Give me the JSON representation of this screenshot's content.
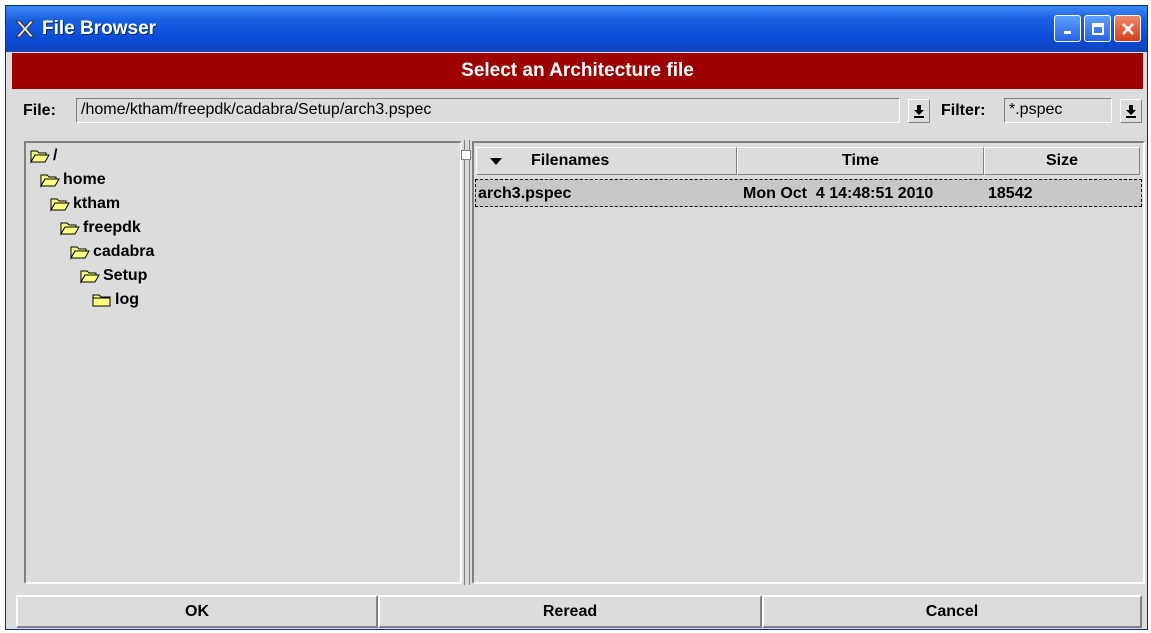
{
  "window": {
    "title": "File Browser",
    "buttons": [
      "minimize",
      "maximize",
      "close"
    ]
  },
  "header": {
    "text": "Select an Architecture file"
  },
  "file_row": {
    "file_label": "File:",
    "file_value": "/home/ktham/freepdk/cadabra/Setup/arch3.pspec",
    "filter_label": "Filter:",
    "filter_value": "*.pspec"
  },
  "tree": {
    "items": [
      {
        "label": "/",
        "icon": "open-folder-icon"
      },
      {
        "label": "home",
        "icon": "open-folder-icon"
      },
      {
        "label": "ktham",
        "icon": "open-folder-icon"
      },
      {
        "label": "freepdk",
        "icon": "open-folder-icon"
      },
      {
        "label": "cadabra",
        "icon": "open-folder-icon"
      },
      {
        "label": "Setup",
        "icon": "open-folder-icon"
      },
      {
        "label": "log",
        "icon": "closed-folder-icon"
      }
    ]
  },
  "file_list": {
    "columns": [
      "Filenames",
      "Time",
      "Size"
    ],
    "sort_indicator": "sort-down-icon",
    "rows": [
      {
        "name": "arch3.pspec",
        "time": "Mon Oct  4 14:48:51 2010",
        "size": "18542"
      }
    ]
  },
  "buttons": {
    "ok": "OK",
    "reread": "Reread",
    "cancel": "Cancel"
  },
  "colors": {
    "header_band": "#9c0000",
    "titlebar": "#0a4cd8",
    "panel": "#dcdcdc",
    "folder": "#ffff80"
  }
}
